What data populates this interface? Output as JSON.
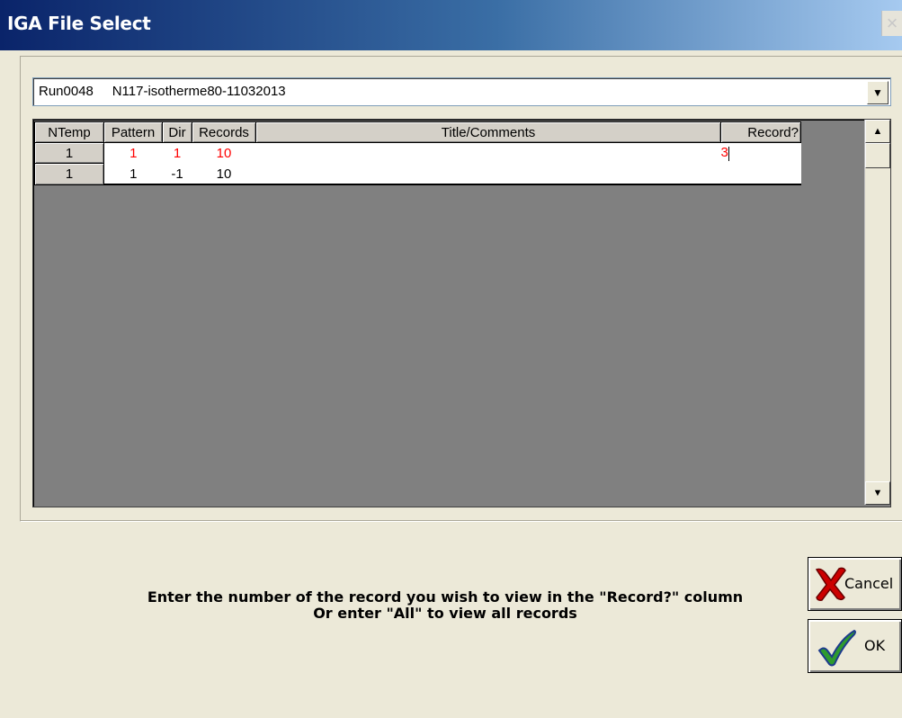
{
  "window": {
    "title": "IGA File Select",
    "close_glyph": "×"
  },
  "file_combo": {
    "value": "Run0048     N117-isotherme80-11032013",
    "arrow_glyph": "▼"
  },
  "grid": {
    "columns": [
      "NTemp",
      "Pattern",
      "Dir",
      "Records",
      "Title/Comments",
      "Record?"
    ],
    "rows": [
      {
        "ntemp": "1",
        "pattern": "1",
        "dir": "1",
        "records": "10",
        "title": "",
        "record": "3",
        "color": "#ff0000"
      },
      {
        "ntemp": "1",
        "pattern": "1",
        "dir": "-1",
        "records": "10",
        "title": "",
        "record": "",
        "color": "#000000"
      }
    ]
  },
  "scrollbar": {
    "up_glyph": "▲",
    "down_glyph": "▼"
  },
  "instructions": {
    "line1": "Enter the number of the record you wish to view in the \"Record?\" column",
    "line2": "Or enter \"All\" to view all records"
  },
  "buttons": {
    "cancel": "Cancel",
    "ok": "OK"
  },
  "icons": {
    "cancel": "red-x-icon",
    "ok": "green-check-icon"
  }
}
